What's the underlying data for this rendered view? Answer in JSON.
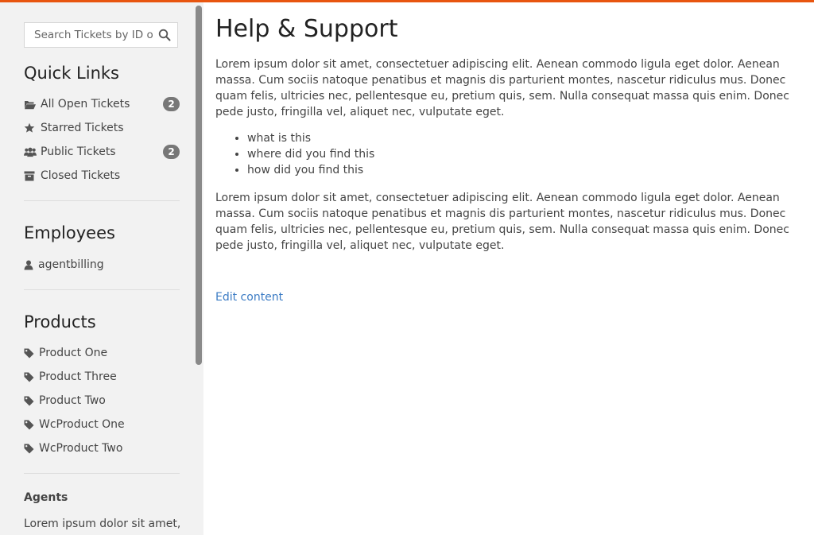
{
  "search": {
    "placeholder": "Search Tickets by ID o"
  },
  "quick_links": {
    "title": "Quick Links",
    "items": [
      {
        "label": "All Open Tickets",
        "icon": "folder-open-icon",
        "badge": "2"
      },
      {
        "label": "Starred Tickets",
        "icon": "star-icon"
      },
      {
        "label": "Public Tickets",
        "icon": "users-icon",
        "badge": "2"
      },
      {
        "label": "Closed Tickets",
        "icon": "archive-icon"
      }
    ]
  },
  "employees": {
    "title": "Employees",
    "items": [
      {
        "label": "agentbilling",
        "icon": "user-icon"
      }
    ]
  },
  "products": {
    "title": "Products",
    "items": [
      {
        "label": "Product One",
        "icon": "tag-icon"
      },
      {
        "label": "Product Three",
        "icon": "tag-icon"
      },
      {
        "label": "Product Two",
        "icon": "tag-icon"
      },
      {
        "label": "WcProduct One",
        "icon": "tag-icon"
      },
      {
        "label": "WcProduct Two",
        "icon": "tag-icon"
      }
    ]
  },
  "agents": {
    "title": "Agents",
    "text": "Lorem ipsum dolor sit amet,"
  },
  "main": {
    "title": "Help & Support",
    "paragraph1": "Lorem ipsum dolor sit amet, consectetuer adipiscing elit. Aenean commodo ligula eget dolor. Aenean massa. Cum sociis natoque penatibus et magnis dis parturient montes, nascetur ridiculus mus. Donec quam felis, ultricies nec, pellentesque eu, pretium quis, sem. Nulla consequat massa quis enim. Donec pede justo, fringilla vel, aliquet nec, vulputate eget.",
    "bullets": [
      "what is this",
      "where did you find this",
      "how did you find this"
    ],
    "paragraph2": "Lorem ipsum dolor sit amet, consectetuer adipiscing elit. Aenean commodo ligula eget dolor. Aenean massa. Cum sociis natoque penatibus et magnis dis parturient montes, nascetur ridiculus mus. Donec quam felis, ultricies nec, pellentesque eu, pretium quis, sem. Nulla consequat massa quis enim. Donec pede justo, fringilla vel, aliquet nec, vulputate eget.",
    "edit_link": "Edit content"
  },
  "colors": {
    "accent": "#e8550f",
    "link": "#3b7bc4",
    "sidebar_bg": "#f2f2f2",
    "badge_bg": "#777777"
  }
}
